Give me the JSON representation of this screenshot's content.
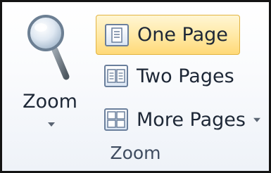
{
  "group": {
    "label": "Zoom",
    "buttons": {
      "zoom": {
        "label": "Zoom",
        "icon": "magnifier-icon",
        "has_dropdown": true
      },
      "one_page": {
        "label": "One Page",
        "icon": "one-page-icon",
        "selected": true
      },
      "two_pages": {
        "label": "Two Pages",
        "icon": "two-pages-icon"
      },
      "more_pages": {
        "label": "More Pages",
        "icon": "more-pages-icon",
        "has_dropdown": true
      }
    }
  },
  "colors": {
    "selected_fill": "#ffe8a3",
    "selected_border": "#e2b341",
    "text": "#1d2736"
  }
}
